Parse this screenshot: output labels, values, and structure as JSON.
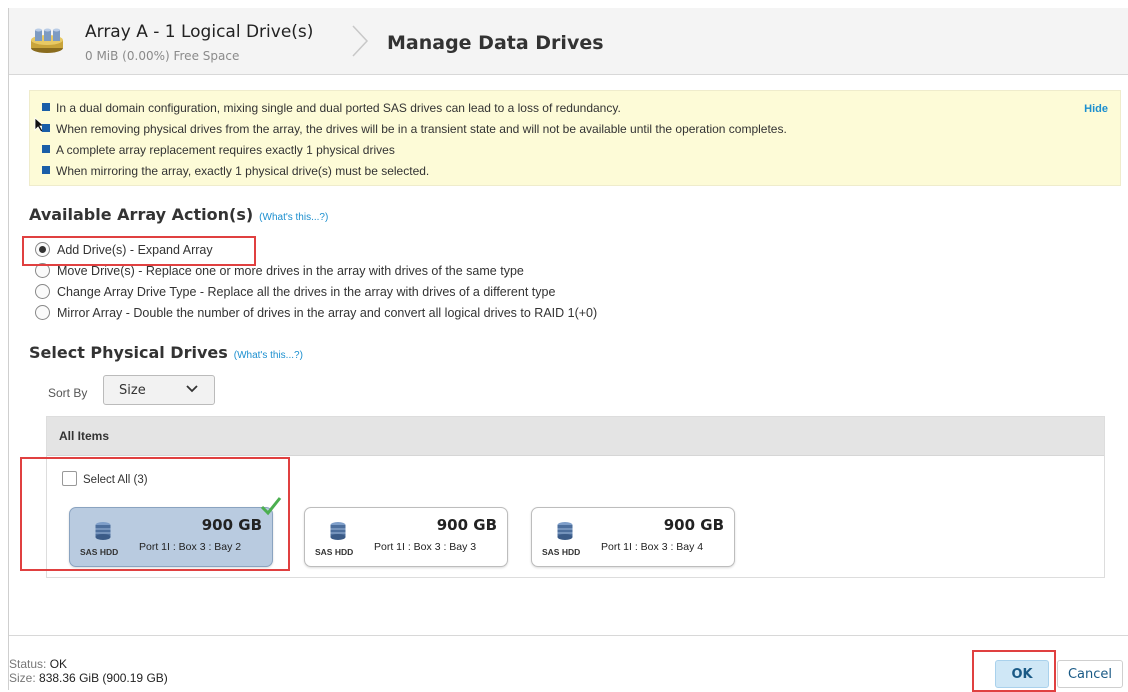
{
  "header": {
    "caption_fragment": "",
    "array_title": "Array A - 1 Logical Drive(s)",
    "array_subtitle": "0 MiB (0.00%) Free Space",
    "page_title": "Manage Data Drives"
  },
  "notice": {
    "hide_label": "Hide",
    "items": [
      "In a dual domain configuration, mixing single and dual ported SAS drives can lead to a loss of redundancy.",
      "When removing physical drives from the array, the drives will be in a transient state and will not be available until the operation completes.",
      "A complete array replacement requires exactly 1 physical drives",
      "When mirroring the array, exactly 1 physical drive(s) must be selected."
    ]
  },
  "actions": {
    "title": "Available Array Action(s)",
    "help": "(What's this...?)",
    "options": [
      {
        "label": "Add Drive(s) - Expand Array",
        "selected": true
      },
      {
        "label": "Move Drive(s) - Replace one or more drives in the array with drives of the same type",
        "selected": false
      },
      {
        "label": "Change Array Drive Type - Replace all the drives in the array with drives of a different type",
        "selected": false
      },
      {
        "label": "Mirror Array - Double the number of drives in the array and convert all logical drives to RAID 1(+0)",
        "selected": false
      }
    ]
  },
  "drives": {
    "title": "Select Physical Drives",
    "help": "(What's this...?)",
    "sort_label": "Sort By",
    "sort_value": "Size",
    "group_label": "All Items",
    "select_all": "Select All (3)",
    "items": [
      {
        "type": "SAS HDD",
        "capacity": "900 GB",
        "location": "Port 1I : Box 3 : Bay 2",
        "selected": true
      },
      {
        "type": "SAS HDD",
        "capacity": "900 GB",
        "location": "Port 1I : Box 3 : Bay 3",
        "selected": false
      },
      {
        "type": "SAS HDD",
        "capacity": "900 GB",
        "location": "Port 1I : Box 3 : Bay 4",
        "selected": false
      }
    ]
  },
  "footer": {
    "status_label": "Status:",
    "status_value": "OK",
    "size_label": "Size:",
    "size_value": "838.36 GiB (900.19 GB)",
    "ok_label": "OK",
    "cancel_label": "Cancel"
  },
  "colors": {
    "accent": "#1c8fcf",
    "notice_bg": "#fdfbd7",
    "selected_card": "#b9cbe0",
    "highlight": "#e04040",
    "check": "#4caf50"
  }
}
